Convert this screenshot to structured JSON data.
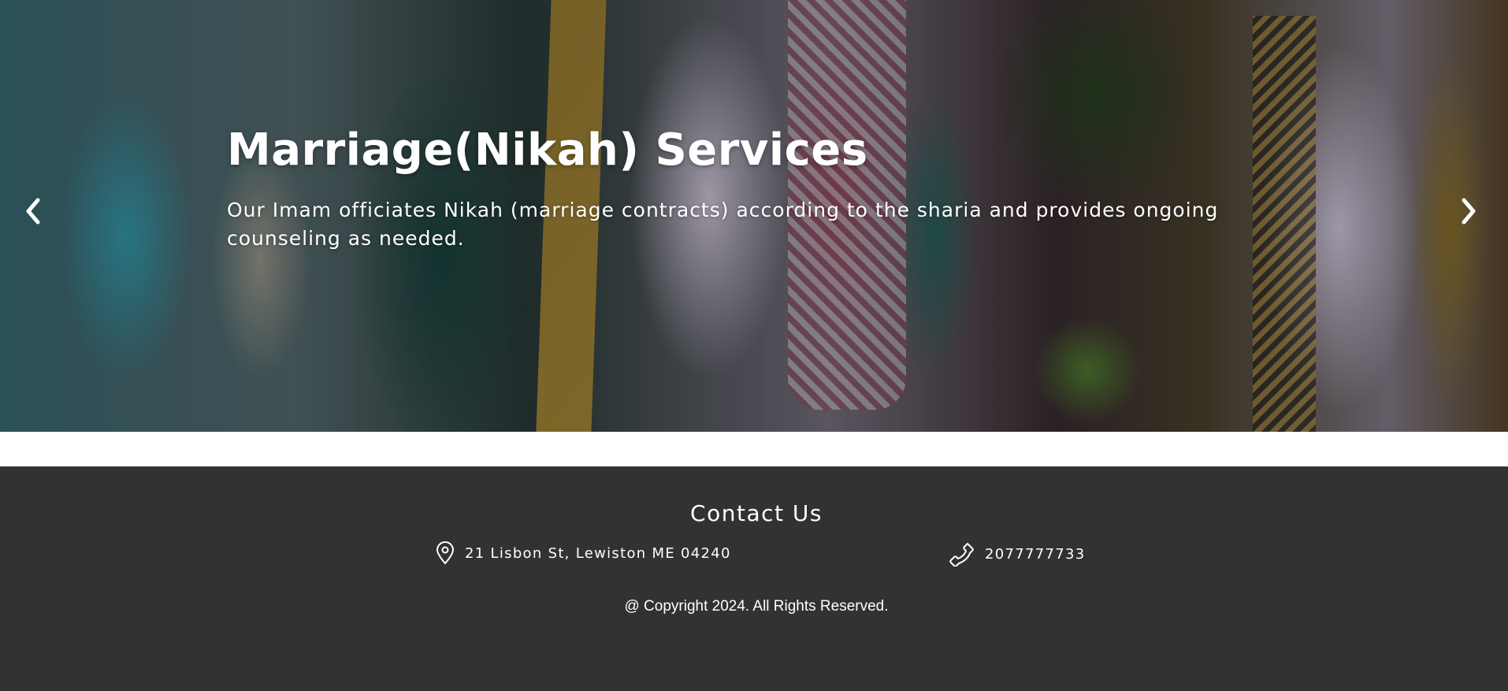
{
  "hero": {
    "title": "Marriage(Nikah) Services",
    "text": "Our Imam officiates Nikah (marriage contracts) according to the sharia and provides ongoing counseling as needed.",
    "prev_icon": "chevron-left-icon",
    "next_icon": "chevron-right-icon"
  },
  "footer": {
    "contact_title": "Contact Us",
    "address": "21 Lisbon St, Lewiston ME 04240",
    "address_icon": "location-pin-icon",
    "phone": "2077777733",
    "phone_icon": "phone-icon",
    "copyright": "@ Copyright 2024. All Rights Reserved.",
    "background_color": "#333231",
    "text_color": "#ffffff"
  }
}
